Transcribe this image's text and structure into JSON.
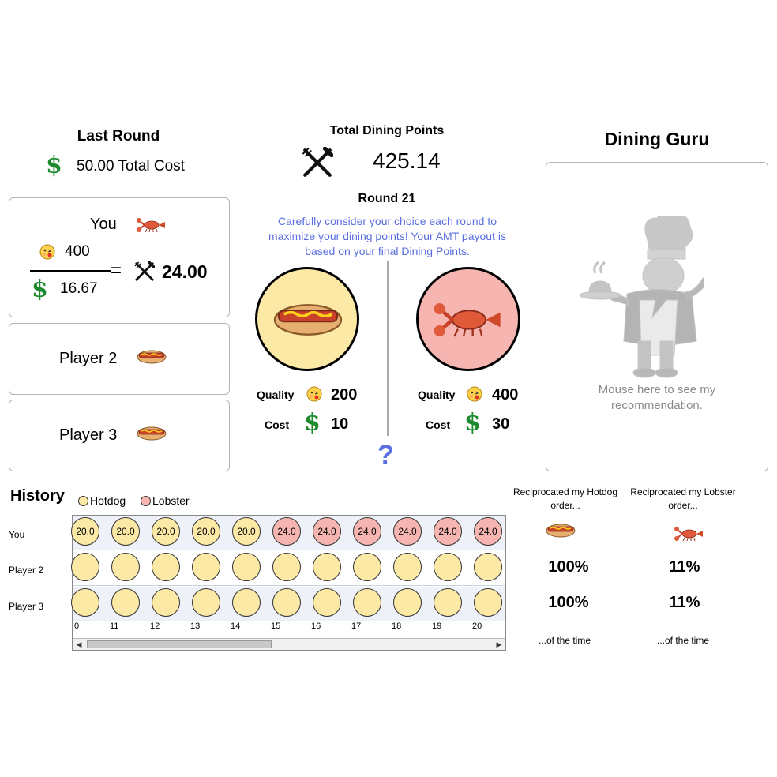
{
  "last_round": {
    "title": "Last Round",
    "total_cost": "50.00 Total Cost"
  },
  "total": {
    "title": "Total Dining Points",
    "value": "425.14",
    "round": "Round 21",
    "instructions": "Carefully consider your choice each round to maximize your dining points!  Your AMT payout is based on your final Dining Points."
  },
  "you_card": {
    "label": "You",
    "quality": "400",
    "cost": "16.67",
    "equals": "=",
    "result": "24.00"
  },
  "players": [
    {
      "label": "Player 2"
    },
    {
      "label": "Player 3"
    }
  ],
  "choices": {
    "hotdog": {
      "quality_label": "Quality",
      "quality": "200",
      "cost_label": "Cost",
      "cost": "10"
    },
    "lobster": {
      "quality_label": "Quality",
      "quality": "400",
      "cost_label": "Cost",
      "cost": "30"
    },
    "help": "?"
  },
  "guru": {
    "title": "Dining Guru",
    "hint": "Mouse here to see my recommendation."
  },
  "history": {
    "title": "History",
    "legend_hotdog": "Hotdog",
    "legend_lobster": "Lobster",
    "row_labels": [
      "You",
      "Player 2",
      "Player 3"
    ],
    "you_values": [
      "20.0",
      "20.0",
      "20.0",
      "20.0",
      "20.0",
      "24.0",
      "24.0",
      "24.0",
      "24.0",
      "24.0",
      "24.0"
    ],
    "axis": [
      "0",
      "11",
      "12",
      "13",
      "14",
      "15",
      "16",
      "17",
      "18",
      "19",
      "20"
    ]
  },
  "reciprocity": {
    "hotdog_title": "Reciprocated my Hotdog order...",
    "lobster_title": "Reciprocated my Lobster order...",
    "p2_hotdog": "100%",
    "p2_lobster": "11%",
    "p3_hotdog": "100%",
    "p3_lobster": "11%",
    "footer_hotdog": "...of the time",
    "footer_lobster": "...of the time"
  },
  "colors": {
    "hotdog_bg": "#fde9a6",
    "lobster_bg": "#f6b5b0",
    "dollar_green": "#1e8a2e",
    "instruction_blue": "#5a6ee0"
  }
}
